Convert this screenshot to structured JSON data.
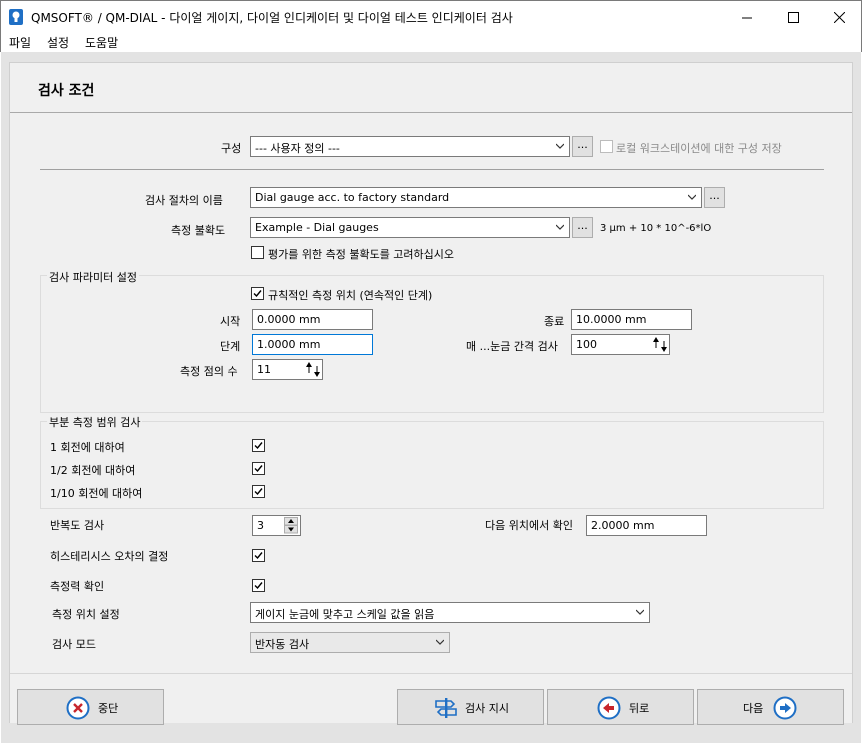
{
  "window": {
    "title": "QMSOFT® / QM-DIAL - 다이얼 게이지, 다이얼 인디케이터 및 다이얼 테스트 인디케이터 검사",
    "app_icon": "lightbulb-icon",
    "minimize_icon": "minimize-icon",
    "maximize_icon": "maximize-icon",
    "close_icon": "close-icon"
  },
  "menu": [
    "파일",
    "설정",
    "도움말"
  ],
  "header": {
    "title": "검사 조건"
  },
  "config": {
    "label": "구성",
    "value": "--- 사용자 정의 ---",
    "dots": "...",
    "save_label": "로컬 워크스테이션에 대한 구성 저장",
    "save_checked": false,
    "save_enabled": false
  },
  "procedure": {
    "label": "검사 절차의 이름",
    "value": "Dial gauge acc. to factory standard",
    "dots": "..."
  },
  "uncertainty": {
    "label": "측정 불확도",
    "value": "Example - Dial gauges",
    "dots": "...",
    "formula": "3 µm + 10 * 10^-6*lO",
    "consider_label": "평가를 위한 측정 불확도를 고려하십시오",
    "consider_checked": false
  },
  "parameters": {
    "group_label": "검사 파라미터 설정",
    "regular_label": "규칙적인 측정 위치 (연속적인 단계)",
    "regular_checked": true,
    "start_label": "시작",
    "start_value": "0.0000 mm",
    "end_label": "종료",
    "end_value": "10.0000 mm",
    "step_label": "단계",
    "step_value": "1.0000 mm",
    "interval_label": "매 ...눈금 간격 검사",
    "interval_value": "100",
    "points_label": "측정 점의 수",
    "points_value": "11"
  },
  "partial": {
    "group_label": "부분 측정 범위 검사",
    "items": [
      {
        "label": "1 회전에 대하여",
        "checked": true
      },
      {
        "label": "1/2 회전에 대하여",
        "checked": true
      },
      {
        "label": "1/10 회전에 대하여",
        "checked": true
      }
    ]
  },
  "repeat": {
    "label": "반복도 검사",
    "value": "3",
    "confirm_label": "다음 위치에서 확인",
    "confirm_value": "2.0000 mm"
  },
  "hysteresis": {
    "label": "히스테리시스 오차의 결정",
    "checked": true
  },
  "force": {
    "label": "측정력 확인",
    "checked": true
  },
  "position": {
    "label": "측정 위치 설정",
    "value": "게이지 눈금에 맞추고 스케일 값을 읽음"
  },
  "mode": {
    "label": "검사 모드",
    "value": "반자동 검사"
  },
  "buttons": {
    "cancel": "중단",
    "instructions": "검사 지시",
    "back": "뒤로",
    "next": "다음"
  },
  "colors": {
    "accent_blue": "#0078d7",
    "icon_red": "#c8262c",
    "icon_blue": "#1f6fc5"
  }
}
